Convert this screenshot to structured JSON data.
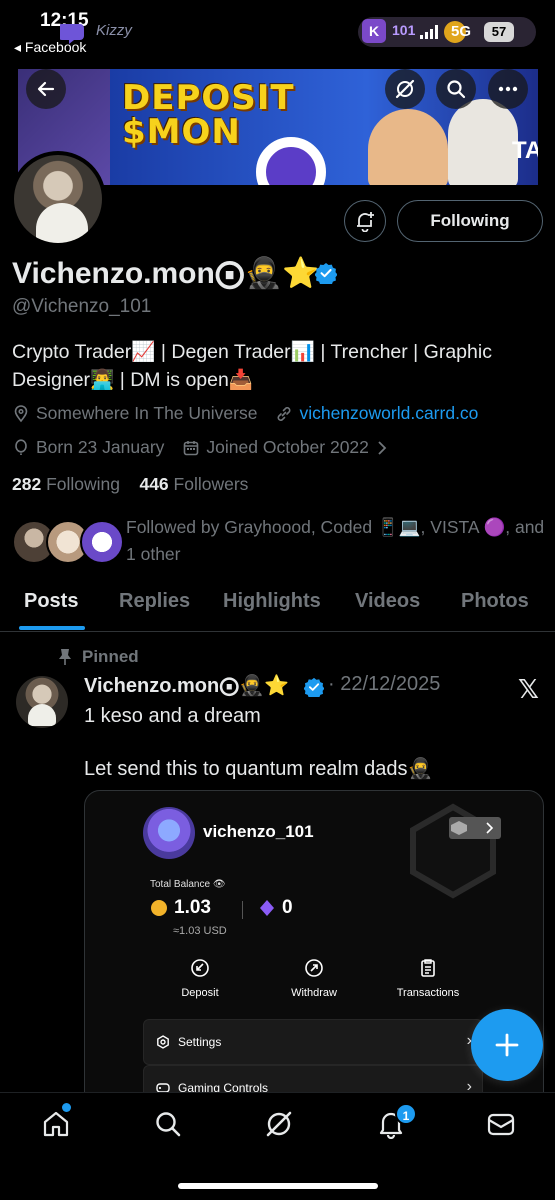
{
  "status_bar": {
    "time": "12:15",
    "back_app": "◂ Facebook",
    "overlay_brand": "Kizzy",
    "k_count": "101",
    "network": "5G",
    "battery": "57"
  },
  "banner": {
    "title_line1": "DEPOSIT",
    "title_line2": "$MON",
    "corner_text": "TA"
  },
  "profile": {
    "display_name": "Vichenzo.mon⨀🥷⭐",
    "handle": "@Vichenzo_101",
    "bio": "Crypto Trader📈 | Degen Trader📊 | Trencher | Graphic Designer👨‍💻 | DM is open📥",
    "location": "Somewhere In The Universe",
    "website": "vichenzoworld.carrd.co",
    "birthday": "Born 23 January",
    "joined": "Joined October 2022",
    "following_count": "282",
    "following_label": "Following",
    "followers_count": "446",
    "followers_label": "Followers",
    "followed_by": "Followed by Grayhoood, Coded 📱💻, VISTA 🟣, and 1 other",
    "following_button": "Following"
  },
  "tabs": [
    {
      "label": "Posts",
      "active": true
    },
    {
      "label": "Replies",
      "active": false
    },
    {
      "label": "Highlights",
      "active": false
    },
    {
      "label": "Videos",
      "active": false
    },
    {
      "label": "Photos",
      "active": false
    }
  ],
  "post": {
    "pinned_label": "Pinned",
    "author": "Vichenzo.mon⨀🥷⭐",
    "date": "· 22/12/2025",
    "line1": "1 keso and a dream",
    "line2": "Let send this to quantum realm dads🥷",
    "media": {
      "username": "vichenzo_101",
      "total_label": "Total Balance 👁",
      "balance_coin": "1.03",
      "balance_gem": "0",
      "usd": "≈1.03 USD",
      "actions": [
        "Deposit",
        "Withdraw",
        "Transactions"
      ],
      "rows": [
        "Settings",
        "Gaming Controls"
      ]
    }
  },
  "nav": {
    "items": [
      "home-icon",
      "search-icon",
      "grok-icon",
      "notifications-icon",
      "messages-icon"
    ],
    "notification_count": "1"
  },
  "colors": {
    "accent": "#1d9bf0",
    "background": "#000000",
    "text_primary": "#e7e9ea",
    "text_secondary": "#71767b",
    "border": "#2f3336"
  }
}
